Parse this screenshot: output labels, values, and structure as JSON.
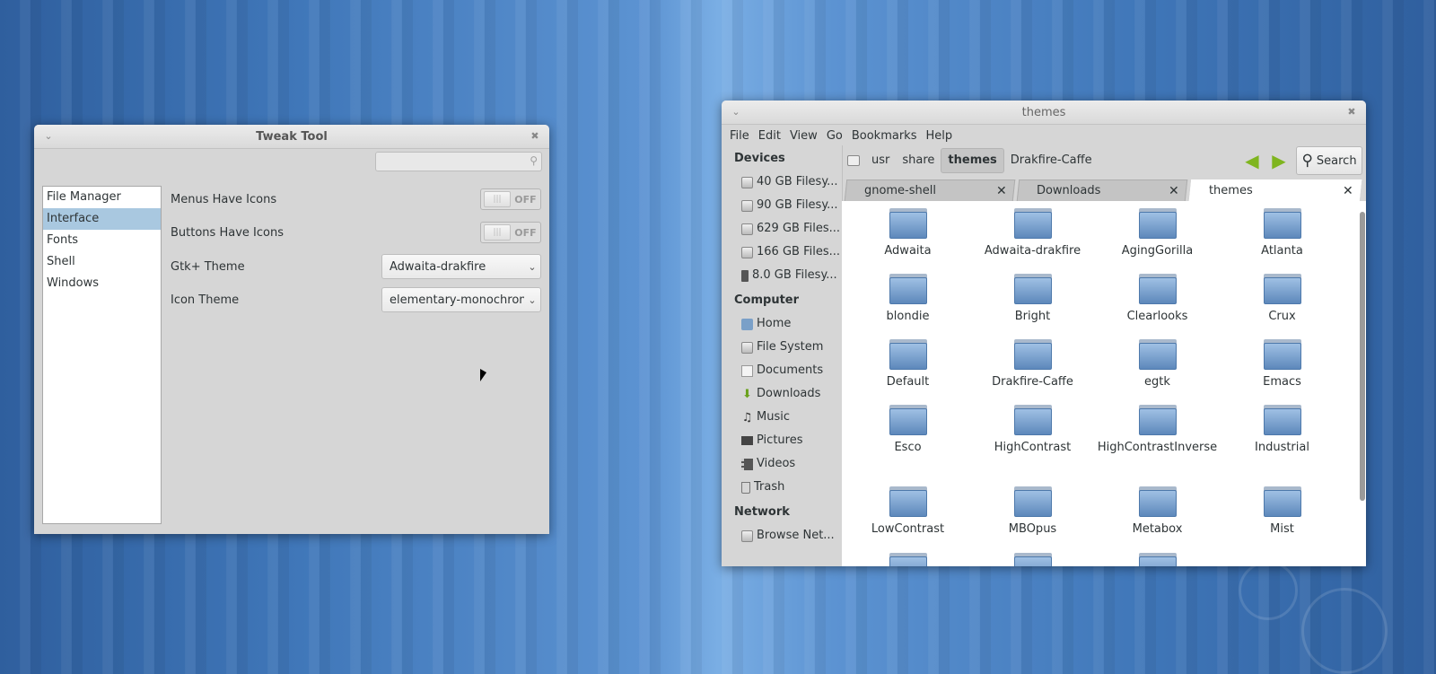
{
  "tweak": {
    "title": "Tweak Tool",
    "search_placeholder": "",
    "categories": [
      "File Manager",
      "Interface",
      "Fonts",
      "Shell",
      "Windows"
    ],
    "selected_category": "Interface",
    "settings": {
      "menus_icons": {
        "label": "Menus Have Icons",
        "state": "OFF"
      },
      "buttons_icons": {
        "label": "Buttons Have Icons",
        "state": "OFF"
      },
      "gtk_theme": {
        "label": "Gtk+ Theme",
        "value": "Adwaita-drakfire"
      },
      "icon_theme": {
        "label": "Icon Theme",
        "value": "elementary-monochrome"
      }
    }
  },
  "files": {
    "title": "themes",
    "menu": [
      "File",
      "Edit",
      "View",
      "Go",
      "Bookmarks",
      "Help"
    ],
    "sidebar": {
      "devices_head": "Devices",
      "devices": [
        "40 GB Filesy...",
        "90 GB Filesy...",
        "629 GB Files...",
        "166 GB Files...",
        "8.0 GB Filesy..."
      ],
      "computer_head": "Computer",
      "computer": [
        "Home",
        "File System",
        "Documents",
        "Downloads",
        "Music",
        "Pictures",
        "Videos",
        "Trash"
      ],
      "network_head": "Network",
      "network": [
        "Browse Net..."
      ]
    },
    "path": [
      "usr",
      "share",
      "themes",
      "Drakfire-Caffe"
    ],
    "current_path": "themes",
    "search_label": "Search",
    "tabs": [
      {
        "label": "gnome-shell"
      },
      {
        "label": "Downloads"
      },
      {
        "label": "themes"
      }
    ],
    "active_tab": "themes",
    "folders": [
      "Adwaita",
      "Adwaita-drakfire",
      "AgingGorilla",
      "Atlanta",
      "blondie",
      "Bright",
      "Clearlooks",
      "Crux",
      "Default",
      "Drakfire-Caffe",
      "egtk",
      "Emacs",
      "Esco",
      "HighContrast",
      "HighContrastInverse",
      "Industrial",
      "LowContrast",
      "MBOpus",
      "Metabox",
      "Mist"
    ]
  }
}
